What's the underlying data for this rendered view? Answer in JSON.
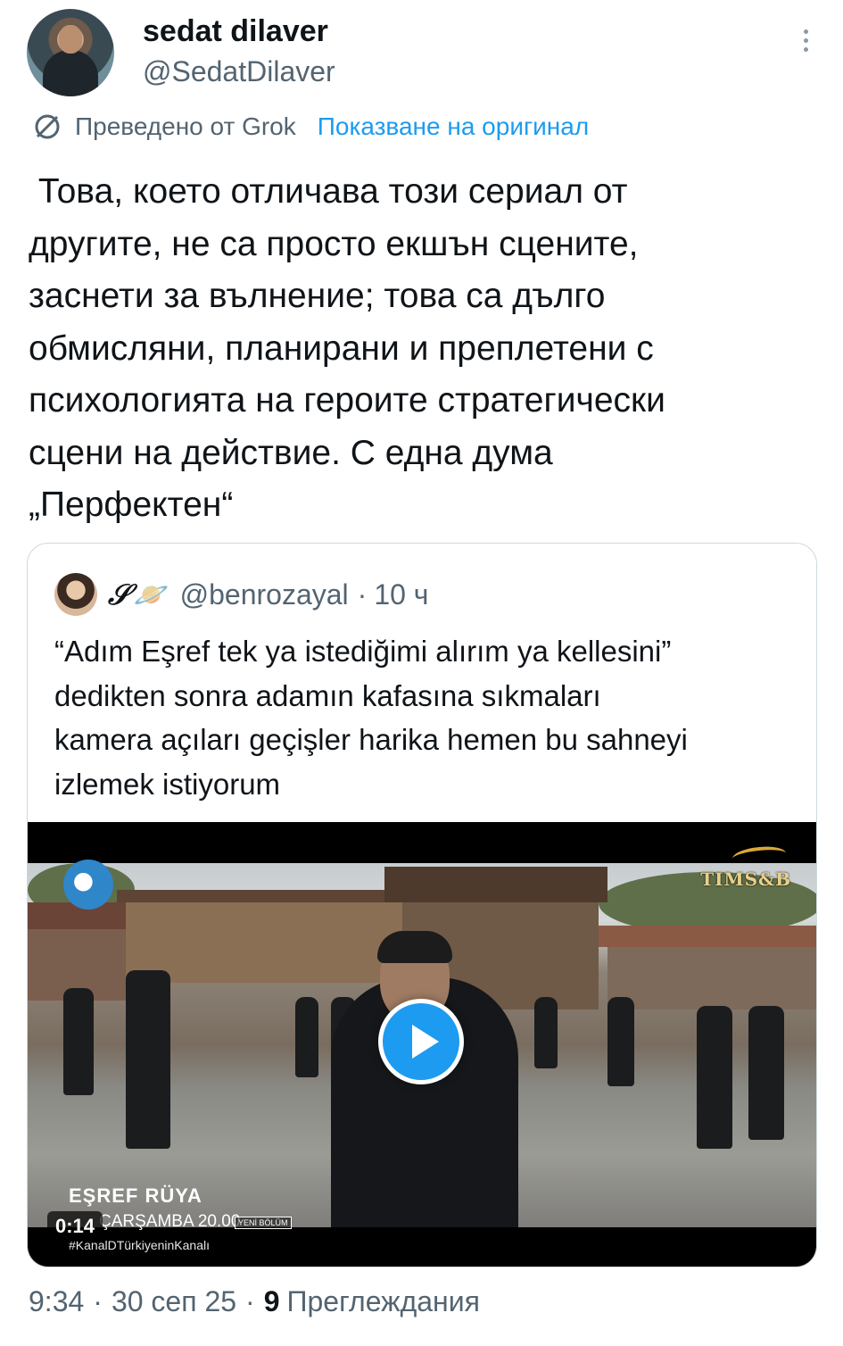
{
  "author": {
    "display_name": "sedat dilaver",
    "handle": "@SedatDilaver"
  },
  "translation": {
    "icon": "translate-icon",
    "translated_by": "Преведено от Grok",
    "show_original": "Показване на оригинал"
  },
  "tweet": {
    "text": " Това, което отличава този сериал от\nдругите, не са просто екшън сцените,\nзаснети за вълнение; това са дълго\nобмисляни, планирани и преплетени с\nпсихологията на героите стратегически\nсцени на действие. С една дума\n„Перфектен“"
  },
  "quoted_tweet": {
    "name": "𝒮",
    "name_emoji": "🪐",
    "handle": "@benrozayal",
    "dot": "·",
    "time": "10 ч",
    "text": "“Adım Eşref tek ya istediğimi alırım ya kellesini”\ndedikten sonra adamın kafasına sıkmaları\nkamera açıları geçişler harika hemen bu sahneyi\nizlemek istiyorum",
    "video": {
      "duration": "0:14",
      "overlay_title": "EŞREF RÜYA",
      "overlay_time": "ÇARŞAMBA 20.00",
      "overlay_badge": "YENİ BÖLÜM",
      "overlay_hashtag": "#KanalDTürkiyeninKanalı",
      "watermark": "TIMS&B",
      "play_icon": "play-icon"
    }
  },
  "meta": {
    "time": "9:34",
    "sep1": "·",
    "date": "30 сеп 25",
    "sep2": "·",
    "views_count": "9",
    "views_label": "Преглеждания"
  },
  "colors": {
    "accent": "#1d9bf0",
    "text_primary": "#0f1419",
    "text_secondary": "#536471",
    "border": "#cfd9de"
  }
}
